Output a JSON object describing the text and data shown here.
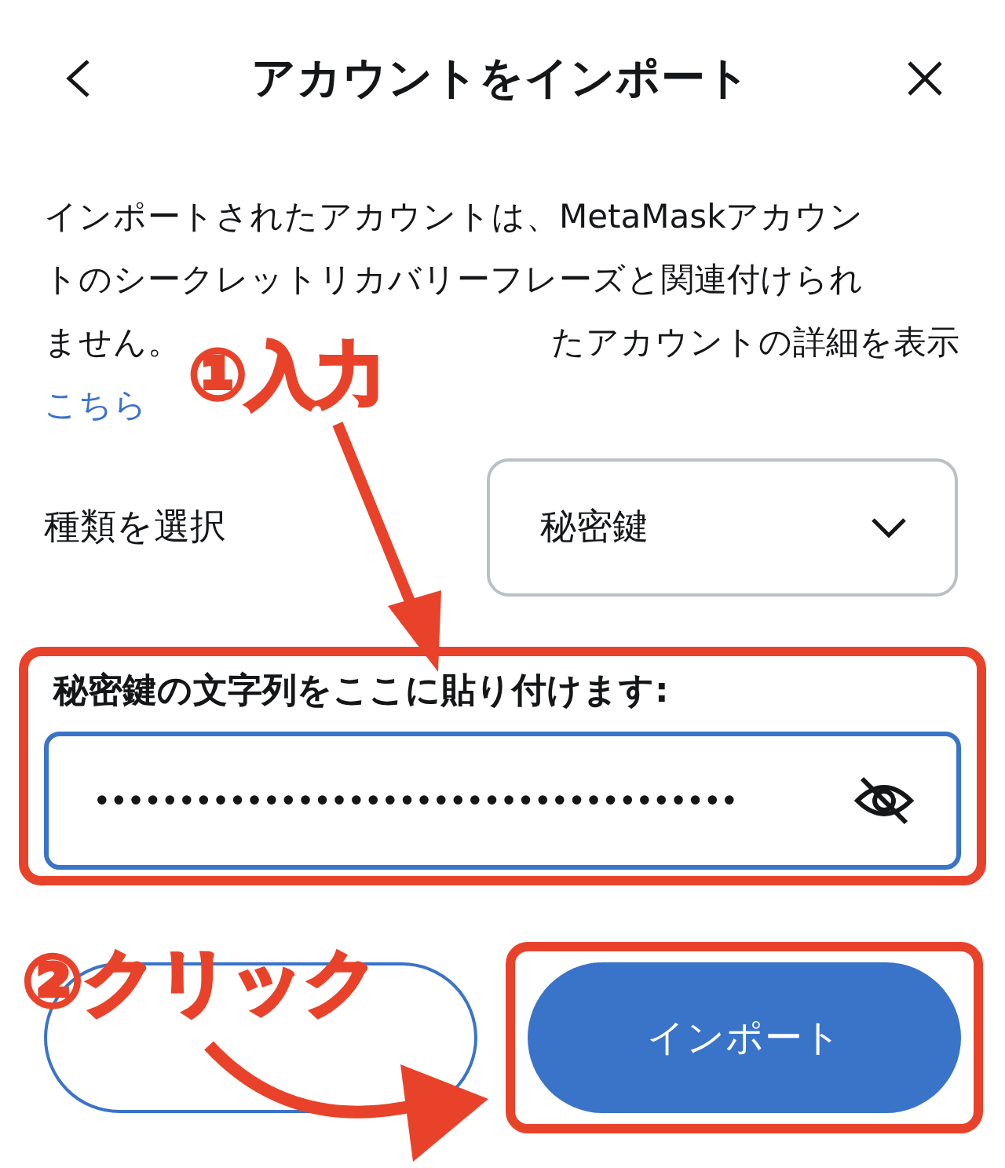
{
  "header": {
    "title": "アカウントをインポート"
  },
  "description": {
    "lines": [
      "インポートされたアカウントは、MetaMaskアカウン",
      "トのシークレットリカバリーフレーズと関連付けられ"
    ],
    "line3_start": "ません。",
    "line3_end": "たアカウントの詳細を表示",
    "link": "こちら"
  },
  "type_select": {
    "label": "種類を選択",
    "value": "秘密鍵"
  },
  "key_field": {
    "label": "秘密鍵の文字列をここに貼り付けます:",
    "value": "••••••••••••••••••••••••••••••••••••••"
  },
  "buttons": [
    {
      "kind": "outline"
    },
    {
      "kind": "primary",
      "label": "インポート"
    }
  ],
  "annotations": [
    {
      "kind": "step",
      "text": "①入力"
    },
    {
      "kind": "step",
      "text": "②クリック"
    }
  ]
}
